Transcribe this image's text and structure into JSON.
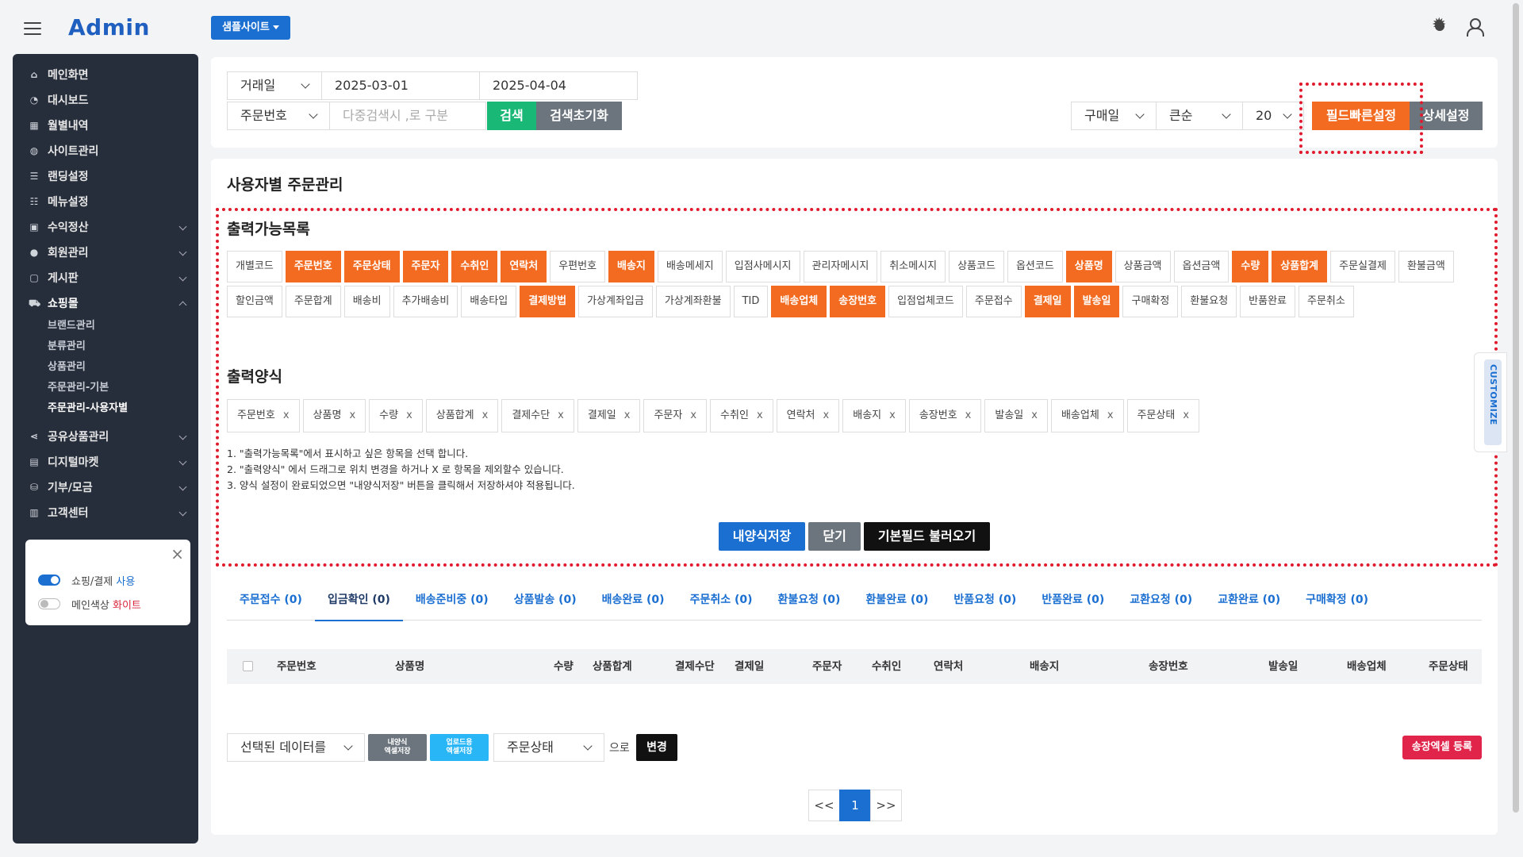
{
  "topbar": {
    "logo": "Admin",
    "site_button": "샘플사이트"
  },
  "sidebar": {
    "items": [
      {
        "icon": "home-icon",
        "glyph": "⌂",
        "label": "메인화면"
      },
      {
        "icon": "dashboard-icon",
        "glyph": "◔",
        "label": "대시보드"
      },
      {
        "icon": "calendar-icon",
        "glyph": "▦",
        "label": "월별내역"
      },
      {
        "icon": "globe-icon",
        "glyph": "◍",
        "label": "사이트관리"
      },
      {
        "icon": "list-icon",
        "glyph": "☰",
        "label": "랜딩설정"
      },
      {
        "icon": "menu-list-icon",
        "glyph": "☷",
        "label": "메뉴설정"
      },
      {
        "icon": "lock-icon",
        "glyph": "▣",
        "label": "수익정산"
      },
      {
        "icon": "user-icon",
        "glyph": "●",
        "label": "회원관리"
      },
      {
        "icon": "clipboard-icon",
        "glyph": "▢",
        "label": "게시판"
      },
      {
        "icon": "cart-icon",
        "glyph": "⛟",
        "label": "쇼핑몰"
      }
    ],
    "shop_submenu": [
      "브랜드관리",
      "분류관리",
      "상품관리",
      "주문관리-기본",
      "주문관리-사용자별"
    ],
    "items_after": [
      {
        "icon": "share-icon",
        "glyph": "⋖",
        "label": "공유상품관리"
      },
      {
        "icon": "file-icon",
        "glyph": "▤",
        "label": "디지털마켓"
      },
      {
        "icon": "donation-icon",
        "glyph": "⛁",
        "label": "기부/모금"
      },
      {
        "icon": "support-icon",
        "glyph": "▥",
        "label": "고객센터"
      }
    ],
    "settings": {
      "shopping_label": "쇼핑/결제",
      "shopping_state": "사용",
      "main_color_label": "메인색상",
      "main_color_value": "화이트"
    }
  },
  "search": {
    "date_type": "거래일",
    "date_from": "2025-03-01",
    "date_to": "2025-04-04",
    "field_type": "주문번호",
    "keyword_placeholder": "다중검색시 ,로 구분",
    "search_button": "검색",
    "reset_button": "검색초기화",
    "sort_field": "구매일",
    "sort_order": "큰순",
    "page_size": "20",
    "quick_field_button": "필드빠른설정",
    "detail_button": "상세설정"
  },
  "main": {
    "title": "사용자별 주문관리",
    "available_title": "출력가능목록",
    "available_fields": [
      {
        "label": "개별코드",
        "selected": false
      },
      {
        "label": "주문번호",
        "selected": true
      },
      {
        "label": "주문상태",
        "selected": true
      },
      {
        "label": "주문자",
        "selected": true
      },
      {
        "label": "수취인",
        "selected": true
      },
      {
        "label": "연락처",
        "selected": true
      },
      {
        "label": "우편번호",
        "selected": false
      },
      {
        "label": "배송지",
        "selected": true
      },
      {
        "label": "배송메세지",
        "selected": false
      },
      {
        "label": "입점사메시지",
        "selected": false
      },
      {
        "label": "관리자메시지",
        "selected": false
      },
      {
        "label": "취소메시지",
        "selected": false
      },
      {
        "label": "상품코드",
        "selected": false
      },
      {
        "label": "옵션코드",
        "selected": false
      },
      {
        "label": "상품명",
        "selected": true
      },
      {
        "label": "상품금액",
        "selected": false
      },
      {
        "label": "옵션금액",
        "selected": false
      },
      {
        "label": "수량",
        "selected": true
      },
      {
        "label": "상품합계",
        "selected": true
      },
      {
        "label": "주문실결제",
        "selected": false
      },
      {
        "label": "환불금액",
        "selected": false
      },
      {
        "label": "할인금액",
        "selected": false
      },
      {
        "label": "주문합계",
        "selected": false
      },
      {
        "label": "배송비",
        "selected": false
      },
      {
        "label": "추가배송비",
        "selected": false
      },
      {
        "label": "배송타입",
        "selected": false
      },
      {
        "label": "결제방법",
        "selected": true
      },
      {
        "label": "가상계좌입금",
        "selected": false
      },
      {
        "label": "가상계좌환불",
        "selected": false
      },
      {
        "label": "TID",
        "selected": false
      },
      {
        "label": "배송업체",
        "selected": true
      },
      {
        "label": "송장번호",
        "selected": true
      },
      {
        "label": "입점업체코드",
        "selected": false
      },
      {
        "label": "주문접수",
        "selected": false
      },
      {
        "label": "결제일",
        "selected": true
      },
      {
        "label": "발송일",
        "selected": true
      },
      {
        "label": "구매확정",
        "selected": false
      },
      {
        "label": "환불요청",
        "selected": false
      },
      {
        "label": "반품완료",
        "selected": false
      },
      {
        "label": "주문취소",
        "selected": false
      }
    ],
    "format_title": "출력양식",
    "format_fields": [
      "주문번호",
      "상품명",
      "수량",
      "상품합계",
      "결제수단",
      "결제일",
      "주문자",
      "수취인",
      "연락처",
      "배송지",
      "송장번호",
      "발송일",
      "배송업체",
      "주문상태"
    ],
    "remove_glyph": "x",
    "notes": [
      "1. \"출력가능목록\"에서 표시하고 싶은 항목을 선택 합니다.",
      "2. \"출력양식\" 에서 드래그로 위치 변경을 하거나 X 로 항목을 제외할수 있습니다.",
      "3. 양식 설정이 완료되었으면 \"내양식저장\" 버튼을 클릭해서 저장하셔야 적용됩니다."
    ],
    "save_button": "내양식저장",
    "close_button": "닫기",
    "load_default_button": "기본필드 불러오기",
    "customize_label": "CUSTOMIZE"
  },
  "status_tabs": [
    "주문접수 (0)",
    "입금확인 (0)",
    "배송준비중 (0)",
    "상품발송 (0)",
    "배송완료 (0)",
    "주문취소 (0)",
    "환불요청 (0)",
    "환불완료 (0)",
    "반품요청 (0)",
    "반품완료 (0)",
    "교환요청 (0)",
    "교환완료 (0)",
    "구매확정 (0)"
  ],
  "active_tab_index": 1,
  "table": {
    "columns": [
      "주문번호",
      "상품명",
      "수량",
      "상품합계",
      "결제수단",
      "결제일",
      "주문자",
      "수취인",
      "연락처",
      "배송지",
      "송장번호",
      "발송일",
      "배송업체",
      "주문상태"
    ]
  },
  "bottom": {
    "selected_data": "선택된 데이터를",
    "my_excel_button": "내양식\n엑셀저장",
    "upload_excel_button": "업로드용\n엑셀저장",
    "status_select": "주문상태",
    "suffix": "으로",
    "change_button": "변경",
    "invoice_excel_button": "송장엑셀 등록"
  },
  "pagination": {
    "prev": "<<",
    "current": "1",
    "next": ">>"
  },
  "colors": {
    "accent": "#1a6fd1",
    "orange": "#f26b21",
    "green": "#19b877",
    "red": "#e0244a",
    "sidebar": "#272e3b"
  }
}
